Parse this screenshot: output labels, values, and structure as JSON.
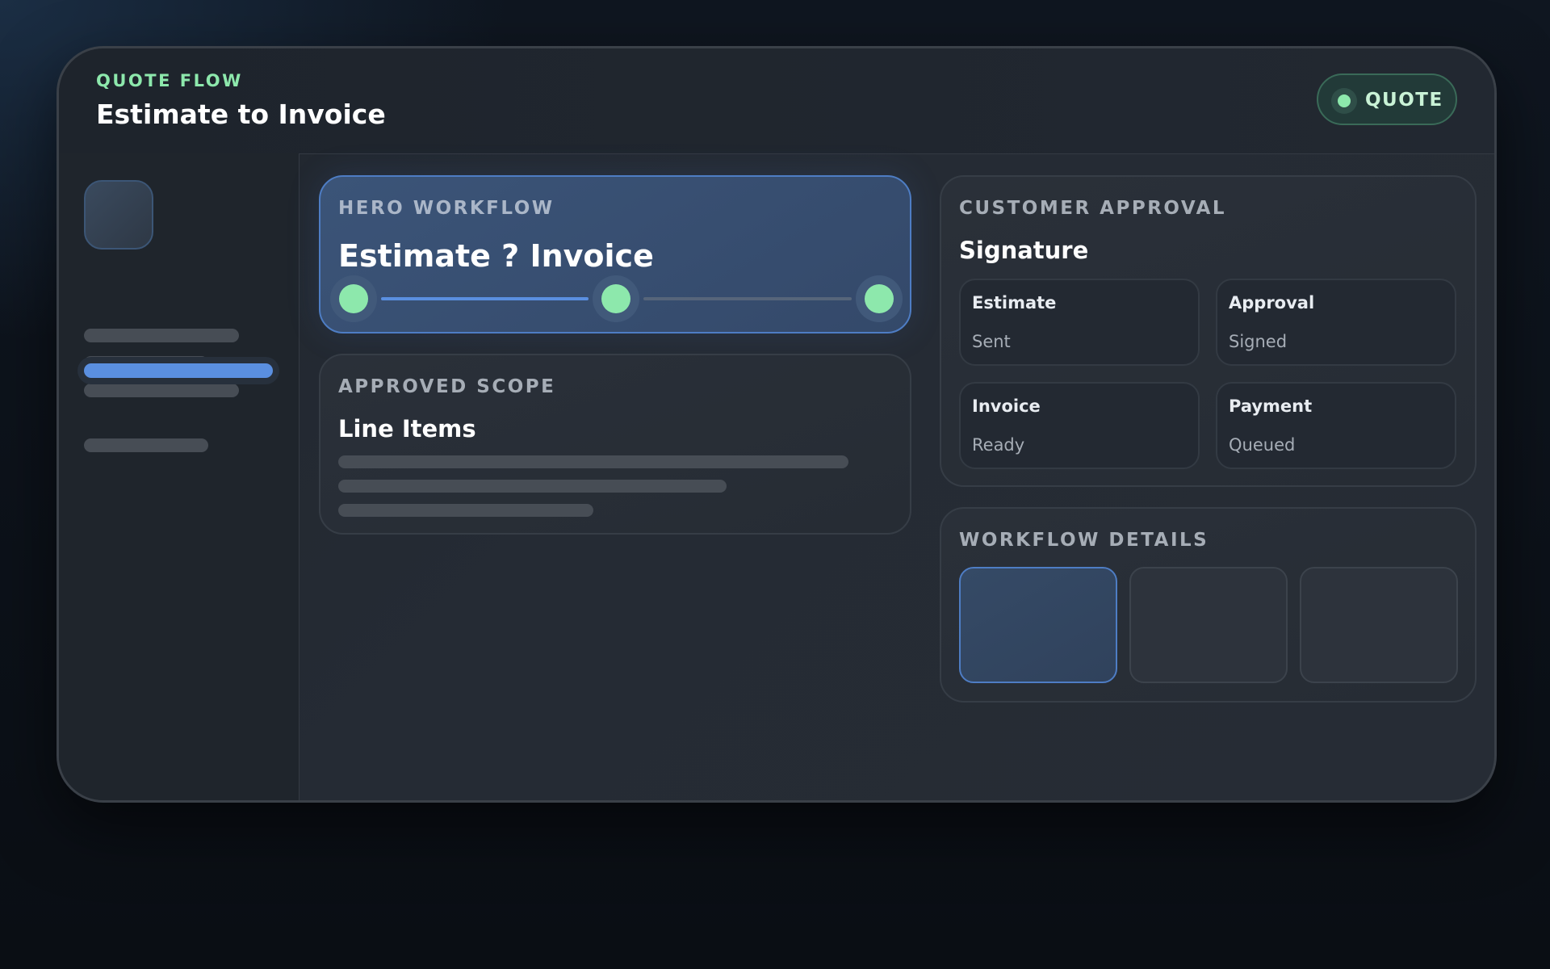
{
  "header": {
    "eyebrow": "QUOTE FLOW",
    "title": "Estimate to Invoice",
    "badge_label": "QUOTE"
  },
  "hero": {
    "label": "HERO WORKFLOW",
    "heading": "Estimate ? Invoice",
    "progress_fraction": 0.5,
    "steps_completed": 3,
    "steps_total": 3
  },
  "scope": {
    "label": "APPROVED SCOPE",
    "heading": "Line Items"
  },
  "approval": {
    "label": "CUSTOMER APPROVAL",
    "heading": "Signature",
    "items": [
      {
        "title": "Estimate",
        "value": "Sent"
      },
      {
        "title": "Approval",
        "value": "Signed"
      },
      {
        "title": "Invoice",
        "value": "Ready"
      },
      {
        "title": "Payment",
        "value": "Queued"
      }
    ]
  },
  "details": {
    "label": "WORKFLOW DETAILS",
    "selected_tile": 0
  },
  "colors": {
    "accent": "#5a8fe0",
    "success": "#8de8ac",
    "background": "#0b1017"
  },
  "icons": {
    "badge": "status-dot-icon",
    "steps": "step-complete-icon"
  }
}
